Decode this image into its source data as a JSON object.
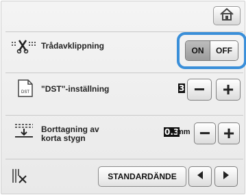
{
  "rows": {
    "thread_cut": {
      "label": "Trådavklippning",
      "toggle_on": "ON",
      "toggle_off": "OFF",
      "selected": "ON"
    },
    "dst": {
      "label": "\"DST\"-inställning",
      "value": "3",
      "icon_text": "DST",
      "minus": "−",
      "plus": "+"
    },
    "short_stitch": {
      "label_line1": "Borttagning av",
      "label_line2": "korta stygn",
      "value": "0.3",
      "unit": "mm",
      "minus": "−",
      "plus": "+"
    },
    "end": {
      "selected_option": "STANDARDÄNDE"
    }
  },
  "icons": {
    "home": "home-icon",
    "thread_cut": "scissors-thread-icon",
    "dst": "dst-file-icon",
    "short_stitch": "short-stitch-icon",
    "end": "thread-end-icon",
    "prev": "left-arrow-icon",
    "next": "right-arrow-icon"
  },
  "colors": {
    "highlight": "#3a8fd9"
  }
}
